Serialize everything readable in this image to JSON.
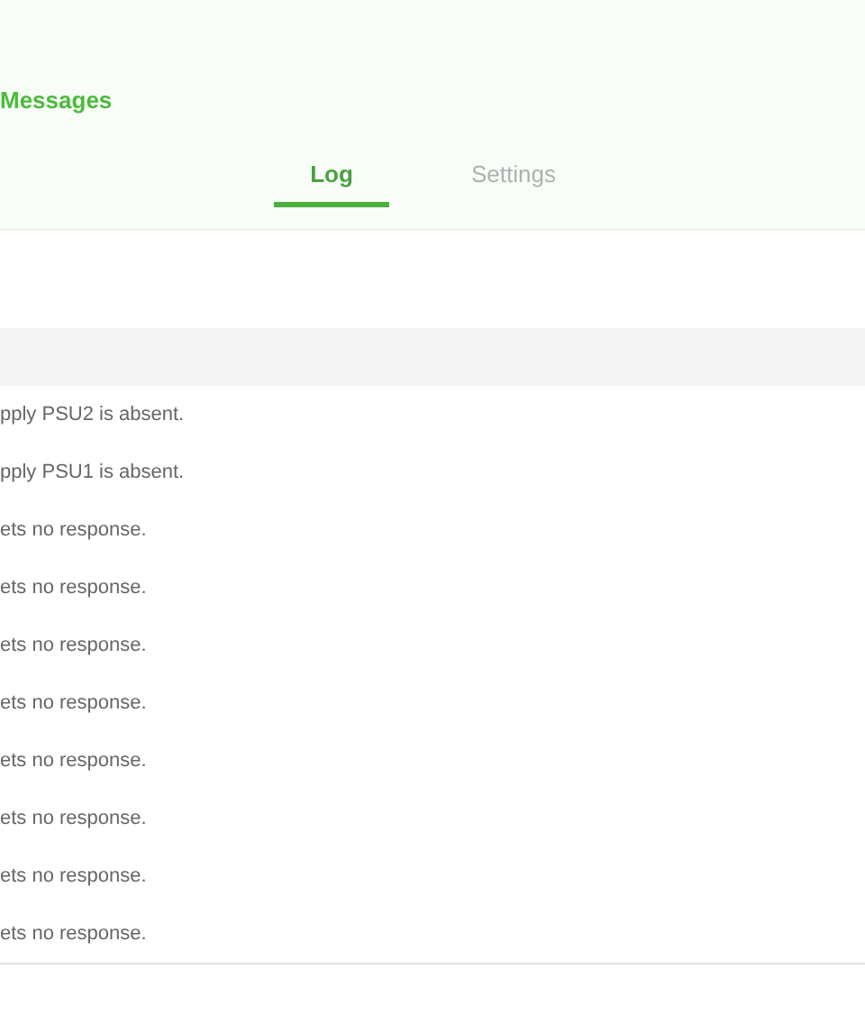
{
  "title": "Messages",
  "tabs": [
    {
      "label": "Log",
      "selected": true
    },
    {
      "label": "Settings",
      "selected": false
    }
  ],
  "table": {
    "rows": [
      {
        "message": "pply PSU2 is absent."
      },
      {
        "message": "pply PSU1 is absent."
      },
      {
        "message": "ets no response."
      },
      {
        "message": "ets no response."
      },
      {
        "message": "ets no response."
      },
      {
        "message": "ets no response."
      },
      {
        "message": "ets no response."
      },
      {
        "message": "ets no response."
      },
      {
        "message": "ets no response."
      },
      {
        "message": "ets no response."
      }
    ]
  }
}
